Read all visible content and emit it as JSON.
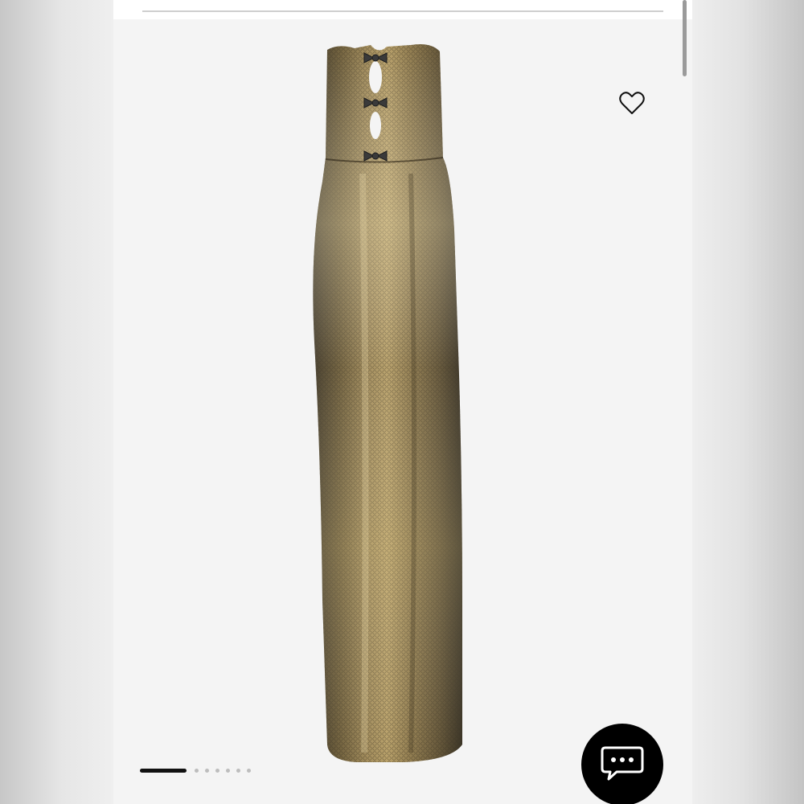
{
  "product": {
    "image_alt": "",
    "wishlist_saved": false,
    "carousel": {
      "total": 7,
      "active_index": 0
    }
  },
  "colors": {
    "page_background": "#f4f4f4",
    "accent": "#111111",
    "dress_gold": "#8a7344"
  },
  "icons": {
    "wishlist": "heart-outline-icon",
    "chat": "chat-bubble-icon"
  }
}
